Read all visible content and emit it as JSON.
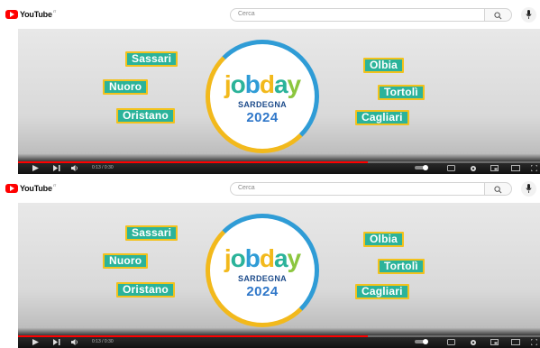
{
  "panels": [
    {
      "logo_text": "YouTube",
      "logo_sup": "IT",
      "search_placeholder": "Cerca",
      "cities": [
        "Sassari",
        "Nuoro",
        "Oristano",
        "Olbia",
        "Tortolì",
        "Cagliari"
      ],
      "logo": {
        "word_letters": [
          "j",
          "o",
          "b",
          "d",
          "a",
          "y"
        ],
        "region": "SARDEGNA",
        "year": "2024"
      },
      "player": {
        "time": "0:13 / 0:30",
        "progress": 0.67
      }
    },
    {
      "logo_text": "YouTube",
      "logo_sup": "IT",
      "search_placeholder": "Cerca",
      "cities": [
        "Sassari",
        "Nuoro",
        "Oristano",
        "Olbia",
        "Tortolì",
        "Cagliari"
      ],
      "logo": {
        "word_letters": [
          "j",
          "o",
          "b",
          "d",
          "a",
          "y"
        ],
        "region": "SARDEGNA",
        "year": "2024"
      },
      "player": {
        "time": "0:13 / 0:30",
        "progress": 0.67
      }
    }
  ],
  "colors": {
    "brand_red": "#ff0000",
    "city_fill": "#2bb39a",
    "city_border": "#f2c21c",
    "year_blue": "#2f77c9"
  },
  "icons": [
    "youtube-logo-icon",
    "search-icon",
    "mic-icon",
    "play-icon",
    "next-icon",
    "volume-icon",
    "autoplay-toggle-icon",
    "subtitles-icon",
    "settings-icon",
    "miniplayer-icon",
    "theater-icon",
    "fullscreen-icon"
  ]
}
